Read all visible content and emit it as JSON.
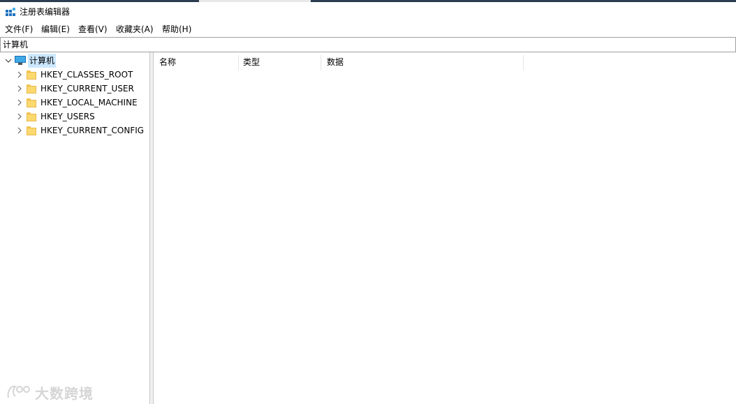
{
  "window": {
    "title": "注册表编辑器"
  },
  "menu": {
    "items": [
      {
        "label": "文件(F)"
      },
      {
        "label": "编辑(E)"
      },
      {
        "label": "查看(V)"
      },
      {
        "label": "收藏夹(A)"
      },
      {
        "label": "帮助(H)"
      }
    ]
  },
  "address": {
    "value": "计算机"
  },
  "tree": {
    "root": {
      "label": "计算机",
      "icon": "computer-icon",
      "expanded": true,
      "selected": true
    },
    "children": [
      {
        "label": "HKEY_CLASSES_ROOT",
        "icon": "folder-icon"
      },
      {
        "label": "HKEY_CURRENT_USER",
        "icon": "folder-icon"
      },
      {
        "label": "HKEY_LOCAL_MACHINE",
        "icon": "folder-icon"
      },
      {
        "label": "HKEY_USERS",
        "icon": "folder-icon"
      },
      {
        "label": "HKEY_CURRENT_CONFIG",
        "icon": "folder-icon"
      }
    ]
  },
  "list": {
    "columns": [
      {
        "label": "名称"
      },
      {
        "label": "类型"
      },
      {
        "label": "数据"
      }
    ]
  },
  "watermark": {
    "text": "大数跨境"
  },
  "colors": {
    "selection": "#cce8ff",
    "folder": "#fcd96e",
    "computer_screen": "#3fa9e6"
  }
}
